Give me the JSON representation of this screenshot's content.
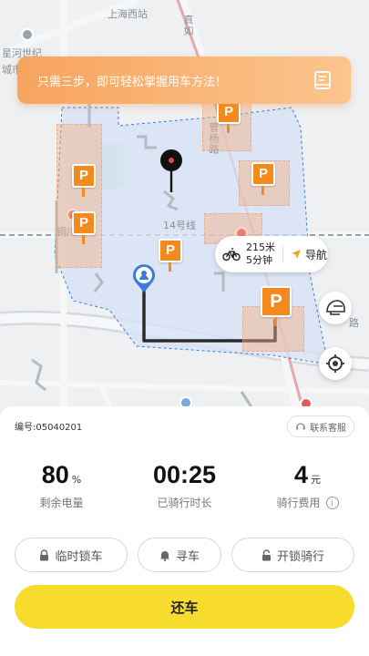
{
  "map": {
    "labels": {
      "station": "上海西站",
      "road_top": "曹杨路",
      "road_right": "曹杨路",
      "left_top": "星河世纪",
      "left_mid": "城市",
      "left_low": "铜川",
      "line14": "14号线",
      "right_edge": "路",
      "top_right": "真如"
    },
    "banner_text": "只需三步，即可轻松掌握用车方法！",
    "nav": {
      "distance": "215米",
      "duration": "5分钟",
      "nav_label": "导航"
    }
  },
  "panel": {
    "bike_id": "编号:05040201",
    "service_label": "联系客服",
    "stats": [
      {
        "value": "80",
        "unit": "%",
        "label": "剩余电量"
      },
      {
        "value": "00:25",
        "unit": "",
        "label": "已骑行时长"
      },
      {
        "value": "4",
        "unit": "元",
        "label": "骑行费用"
      }
    ],
    "actions": {
      "temp_lock": "临时锁车",
      "find_bike": "寻车",
      "unlock_ride": "开锁骑行"
    },
    "return_label": "还车",
    "info_glyph": "i"
  },
  "colors": {
    "accent_yellow": "#f7dc2e",
    "parking_orange": "#f28a1e",
    "banner_orange": "#f7a45e",
    "zone_blue": "#d6e2f5"
  }
}
